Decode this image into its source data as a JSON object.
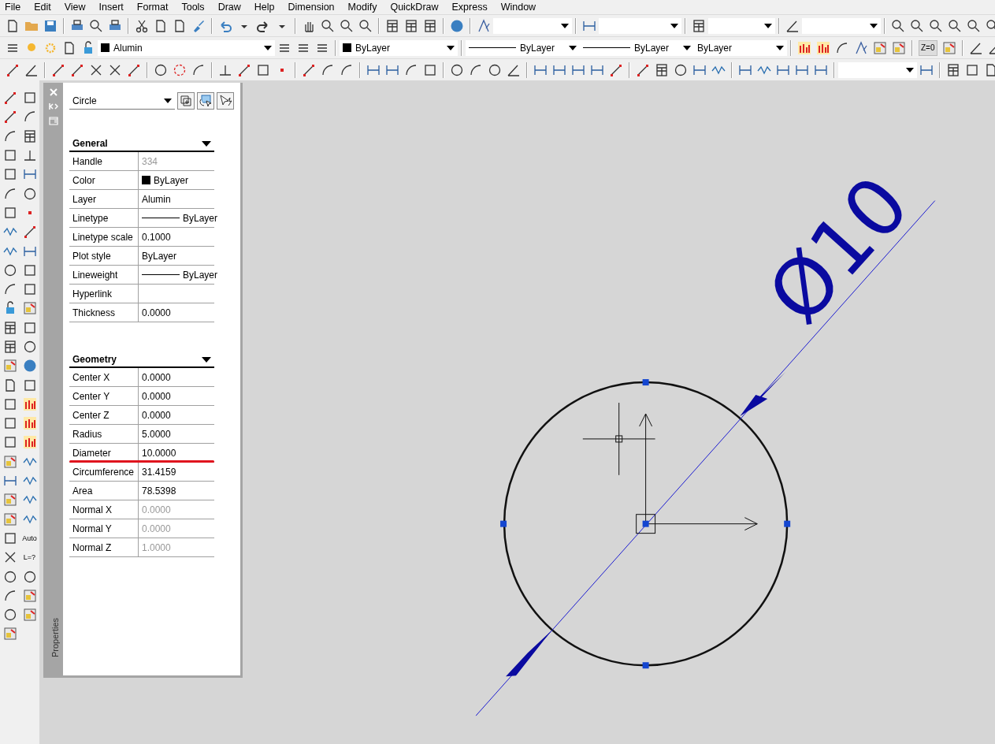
{
  "menu": [
    "File",
    "Edit",
    "View",
    "Insert",
    "Format",
    "Tools",
    "Draw",
    "Help",
    "Dimension",
    "Modify",
    "QuickDraw",
    "Express",
    "Window"
  ],
  "toolbar": {
    "layer": "Alumin",
    "color_dropdown": "ByLayer",
    "linetype": "ByLayer",
    "lineweight": "ByLayer",
    "plot_style": "ByLayer",
    "z_button": "Z=0"
  },
  "side_toolbar": {
    "auto_button": "Auto",
    "length_button": "L=?"
  },
  "properties": {
    "title": "Properties",
    "object_type": "Circle",
    "sections": [
      {
        "title": "General",
        "expanded": true,
        "rows": [
          {
            "label": "Handle",
            "value": "334",
            "kind": "text",
            "disabled": true,
            "highlighted": false
          },
          {
            "label": "Color",
            "value": "ByLayer",
            "kind": "swatch",
            "disabled": false,
            "highlighted": false
          },
          {
            "label": "Layer",
            "value": "Alumin",
            "kind": "text",
            "disabled": false,
            "highlighted": false
          },
          {
            "label": "Linetype",
            "value": "ByLayer",
            "kind": "line",
            "disabled": false,
            "highlighted": false
          },
          {
            "label": "Linetype scale",
            "value": "0.1000",
            "kind": "text",
            "disabled": false,
            "highlighted": false
          },
          {
            "label": "Plot style",
            "value": "ByLayer",
            "kind": "text",
            "disabled": false,
            "highlighted": false
          },
          {
            "label": "Lineweight",
            "value": "ByLayer",
            "kind": "line",
            "disabled": false,
            "highlighted": false
          },
          {
            "label": "Hyperlink",
            "kind": "text",
            "disabled": false,
            "highlighted": false
          },
          {
            "label": "Thickness",
            "value": "0.0000",
            "kind": "text",
            "disabled": false,
            "highlighted": false
          }
        ]
      },
      {
        "title": "Geometry",
        "expanded": true,
        "rows": [
          {
            "label": "Center X",
            "value": "0.0000",
            "kind": "text",
            "disabled": false,
            "highlighted": false
          },
          {
            "label": "Center Y",
            "value": "0.0000",
            "kind": "text",
            "disabled": false,
            "highlighted": false
          },
          {
            "label": "Center Z",
            "value": "0.0000",
            "kind": "text",
            "disabled": false,
            "highlighted": false
          },
          {
            "label": "Radius",
            "value": "5.0000",
            "kind": "text",
            "disabled": false,
            "highlighted": false
          },
          {
            "label": "Diameter",
            "value": "10.0000",
            "kind": "text",
            "disabled": false,
            "highlighted": true
          },
          {
            "label": "Circumference",
            "value": "31.4159",
            "kind": "text",
            "disabled": false,
            "highlighted": false
          },
          {
            "label": "Area",
            "value": "78.5398",
            "kind": "text",
            "disabled": false,
            "highlighted": false
          },
          {
            "label": "Normal X",
            "value": "0.0000",
            "kind": "text",
            "disabled": true,
            "highlighted": false
          },
          {
            "label": "Normal Y",
            "value": "0.0000",
            "kind": "text",
            "disabled": true,
            "highlighted": false
          },
          {
            "label": "Normal Z",
            "value": "1.0000",
            "kind": "text",
            "disabled": true,
            "highlighted": false
          }
        ]
      }
    ]
  },
  "drawing": {
    "dimension_text": "Ø10"
  }
}
